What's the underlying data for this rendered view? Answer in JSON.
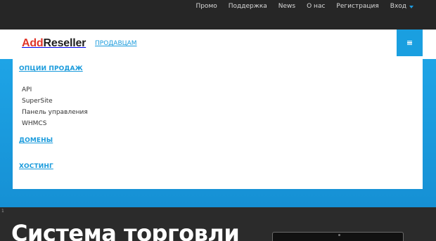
{
  "topnav": {
    "items": [
      "Промо",
      "Поддержка",
      "News",
      "О нас",
      "Регистрация"
    ],
    "login_label": "Вход"
  },
  "header": {
    "logo_part1": "Add",
    "logo_part2": "Reseller",
    "sellers_link": "ПРОДАВЦАМ",
    "menu_icon": "hamburger-icon"
  },
  "dropdown": {
    "sections": [
      {
        "title": "ОПЦИИ ПРОДАЖ",
        "items": [
          "API",
          "SuperSite",
          "Панель управления",
          "WHMCS"
        ]
      },
      {
        "title": "ДОМЕНЫ"
      },
      {
        "title": "ХОСТИНГ"
      }
    ]
  },
  "hero": {
    "marker": "1",
    "headline": "Система торговли"
  },
  "colors": {
    "accent": "#1a9fe0",
    "brand_red": "#e0352a",
    "dark_bg": "#262626"
  }
}
